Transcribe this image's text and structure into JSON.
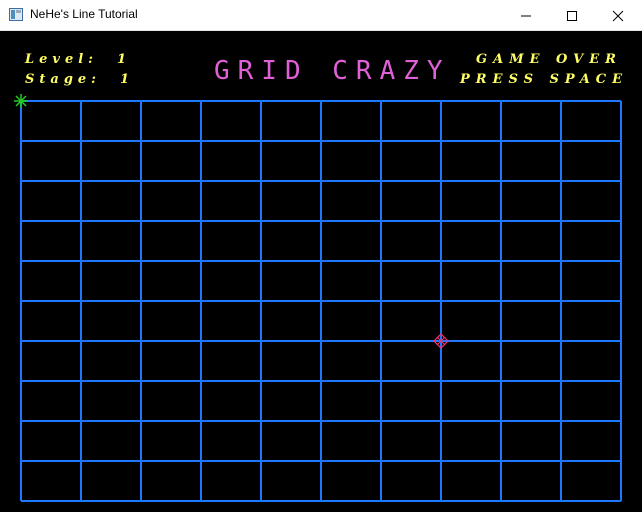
{
  "window": {
    "title": "NeHe's Line Tutorial",
    "icon": "app-window-icon",
    "controls": [
      "minimize-icon",
      "maximize-icon",
      "close-icon"
    ]
  },
  "hud": {
    "level_label": "Level:",
    "level_value": "1",
    "stage_label": "Stage:",
    "stage_value": "1",
    "status_line1": "GAME OVER",
    "status_line2": "PRESS SPACE"
  },
  "game_title": "GRID CRAZY",
  "grid": {
    "columns": 10,
    "rows": 10,
    "player_cell": {
      "col": 0,
      "row": 0
    },
    "enemy_cell": {
      "col": 7,
      "row": 6
    }
  },
  "colors": {
    "grid_line": "#1e78ff",
    "hud_text": "#ffff66",
    "title_text": "#e060d8",
    "player": "#22cc22",
    "enemy": "#ff3070",
    "background": "#000000"
  }
}
